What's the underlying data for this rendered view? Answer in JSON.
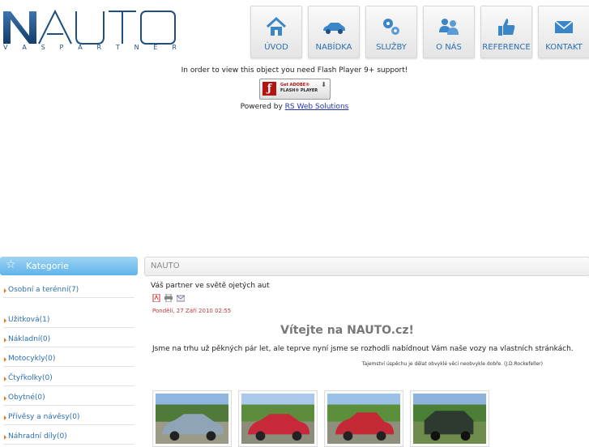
{
  "header": {
    "logo_text": "NAUTO",
    "logo_sub": [
      "V",
      "A",
      "S",
      "P",
      "A",
      "R",
      "T",
      "N",
      "E",
      "R"
    ]
  },
  "nav": [
    {
      "label": "ÚVOD",
      "icon": "home-icon"
    },
    {
      "label": "NABÍDKA",
      "icon": "car-icon"
    },
    {
      "label": "SLUŽBY",
      "icon": "gears-icon"
    },
    {
      "label": "O NÁS",
      "icon": "people-icon"
    },
    {
      "label": "REFERENCE",
      "icon": "thumbs-up-icon"
    },
    {
      "label": "KONTAKT",
      "icon": "envelope-icon"
    }
  ],
  "flash": {
    "message": "In order to view this object you need Flash Player 9+ support!",
    "badge_line1": "Get ADOBE®",
    "badge_line2": "FLASH® PLAYER",
    "powered_prefix": "Powered by ",
    "powered_link": "RS Web Solutions"
  },
  "sidebar": {
    "title": "Kategorie",
    "items": [
      {
        "label": "Osobní a terénní(7)"
      },
      {
        "label": "Užitková(1)"
      },
      {
        "label": "Nákladní(0)"
      },
      {
        "label": "Motocykly(0)"
      },
      {
        "label": "Čtyřkolky(0)"
      },
      {
        "label": "Obytné(0)"
      },
      {
        "label": "Přívěsy a návěsy(0)"
      },
      {
        "label": "Náhradní díly(0)"
      }
    ]
  },
  "main": {
    "heading": "NAUTO",
    "article_title": "Váš partner ve světě ojetých aut",
    "date": "Pondělí, 27 Září 2010 02:55",
    "welcome": "Vítejte na NAUTO.cz!",
    "intro": "Jsme na trhu už pěkných pár let, ale teprve nyní jsme se rozhodli nabídnout Vám naše vozy na vlastních stránkách.",
    "quote": "Tajemství úspěchu je dělat obvyklé věci neobvykle dobře. (J.D.Rockefeller)"
  },
  "colors": {
    "accent": "#2a6fb0",
    "sidebar_header": "#6bbcee",
    "bullet": "#e77b1c",
    "date": "#b83838"
  }
}
